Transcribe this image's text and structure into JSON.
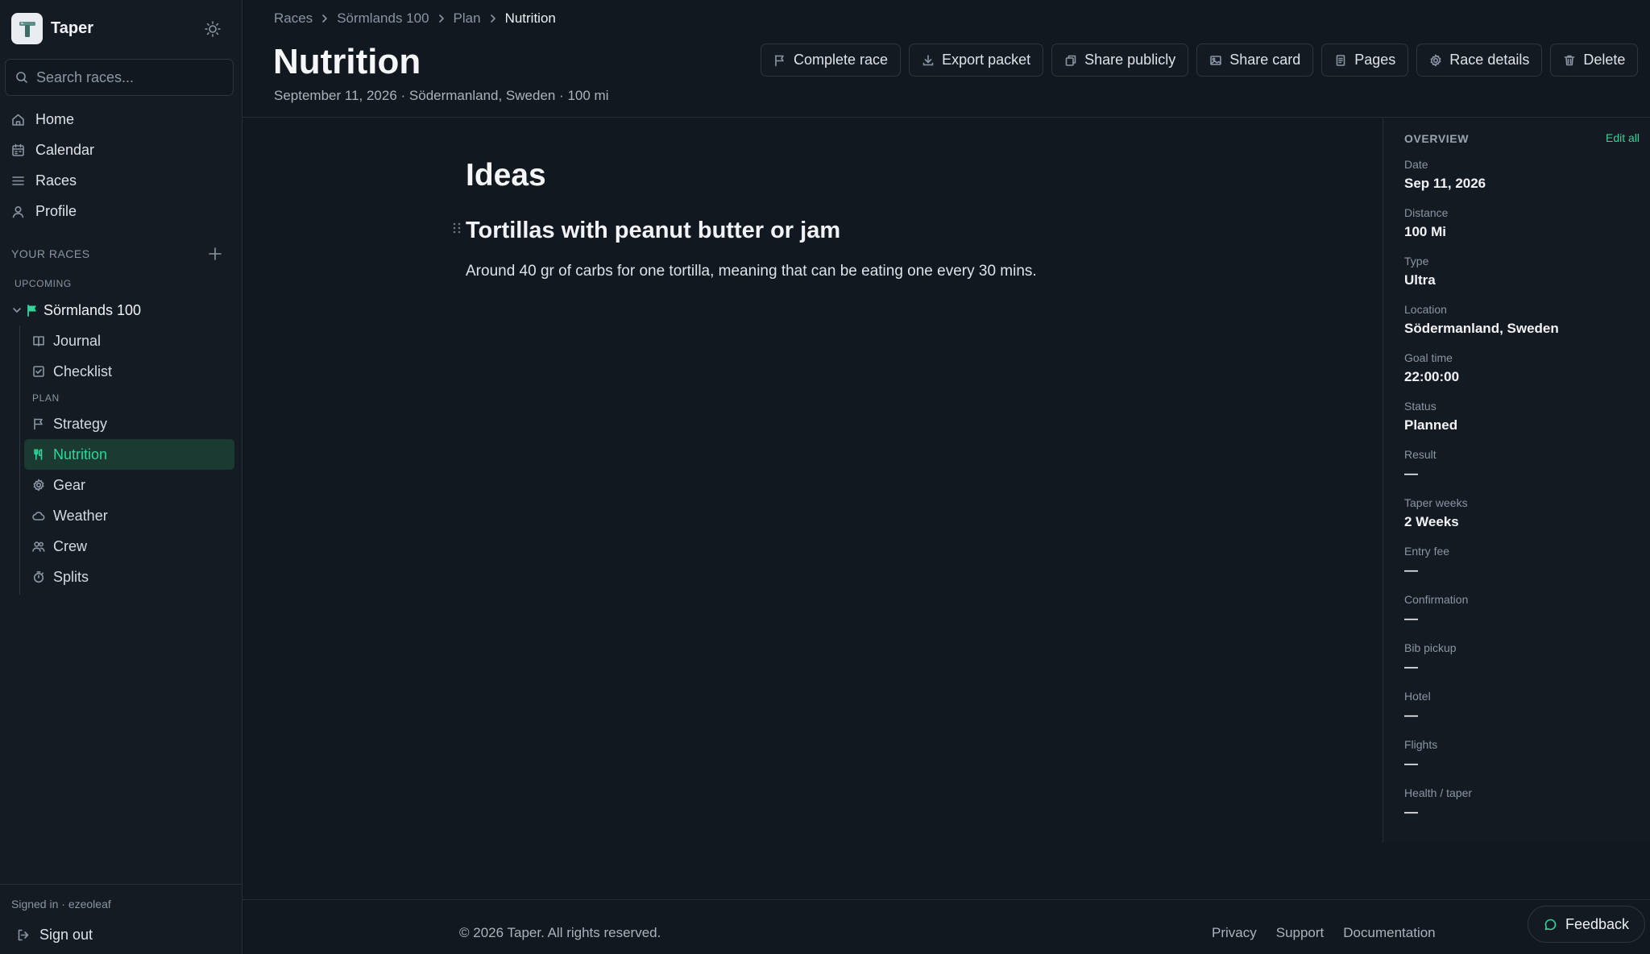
{
  "app": {
    "name": "Taper"
  },
  "search": {
    "placeholder": "Search races..."
  },
  "nav": [
    {
      "label": "Home",
      "icon": "home-icon"
    },
    {
      "label": "Calendar",
      "icon": "calendar-icon"
    },
    {
      "label": "Races",
      "icon": "list-icon"
    },
    {
      "label": "Profile",
      "icon": "user-icon"
    }
  ],
  "sidebar": {
    "your_races": "YOUR RACES",
    "upcoming": "UPCOMING",
    "race_name": "Sörmlands 100",
    "items_top": [
      {
        "label": "Journal",
        "icon": "book-icon"
      },
      {
        "label": "Checklist",
        "icon": "checkbox-icon"
      }
    ],
    "plan_label": "PLAN",
    "plan_items": [
      {
        "label": "Strategy",
        "icon": "flag-icon"
      },
      {
        "label": "Nutrition",
        "icon": "utensils-icon",
        "active": true
      },
      {
        "label": "Gear",
        "icon": "gear-icon"
      },
      {
        "label": "Weather",
        "icon": "cloud-icon"
      },
      {
        "label": "Crew",
        "icon": "users-icon"
      },
      {
        "label": "Splits",
        "icon": "timer-icon"
      }
    ],
    "signed_in": "Signed in · ezeoleaf",
    "sign_out": "Sign out"
  },
  "breadcrumb": [
    "Races",
    "Sörmlands 100",
    "Plan",
    "Nutrition"
  ],
  "page": {
    "title": "Nutrition",
    "subtitle": "September 11, 2026 · Södermanland, Sweden · 100 mi"
  },
  "toolbar": {
    "complete_race": "Complete race",
    "export_packet": "Export packet",
    "share_publicly": "Share publicly",
    "share_card": "Share card",
    "pages": "Pages",
    "race_details": "Race details",
    "delete": "Delete"
  },
  "content": {
    "heading": "Ideas",
    "idea_title": "Tortillas with peanut butter or jam",
    "idea_body": "Around 40 gr of carbs for one tortilla, meaning that can be eating one every 30 mins."
  },
  "overview": {
    "title": "OVERVIEW",
    "edit_all": "Edit all",
    "fields": [
      {
        "label": "Date",
        "value": "Sep 11, 2026"
      },
      {
        "label": "Distance",
        "value": "100 Mi"
      },
      {
        "label": "Type",
        "value": "Ultra"
      },
      {
        "label": "Location",
        "value": "Södermanland, Sweden"
      },
      {
        "label": "Goal time",
        "value": "22:00:00"
      },
      {
        "label": "Status",
        "value": "Planned"
      },
      {
        "label": "Result",
        "value": "—"
      },
      {
        "label": "Taper weeks",
        "value": "2 Weeks"
      },
      {
        "label": "Entry fee",
        "value": "—"
      },
      {
        "label": "Confirmation",
        "value": "—"
      },
      {
        "label": "Bib pickup",
        "value": "—"
      },
      {
        "label": "Hotel",
        "value": "—"
      },
      {
        "label": "Flights",
        "value": "—"
      },
      {
        "label": "Health / taper",
        "value": "—"
      }
    ]
  },
  "footer": {
    "copyright": "© 2026 Taper. All rights reserved.",
    "links": [
      "Privacy",
      "Support",
      "Documentation"
    ],
    "feedback": "Feedback"
  },
  "colors": {
    "accent": "#34d399",
    "background": "#121820",
    "sidebar": "#151b23"
  }
}
